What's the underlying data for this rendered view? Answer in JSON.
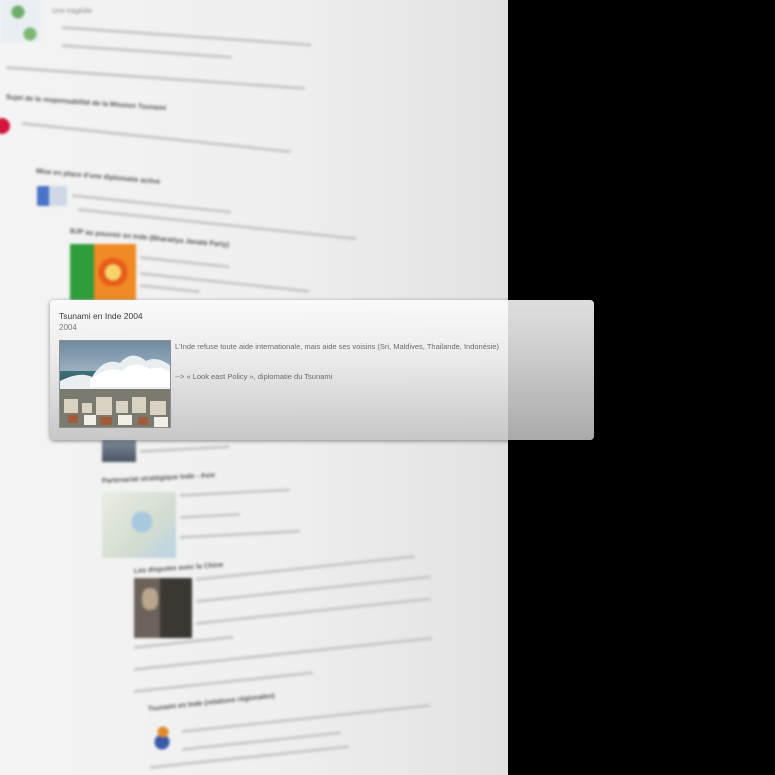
{
  "background_page": {
    "heading_responsibility": "Sujet de la responsabilité de la Mission Tsunami",
    "intro_text": "Une tragédie",
    "section_1": "Mise en place d'une diplomatie active",
    "section_2": "BJP au pouvoir en Inde (Bharatiya Janata Party)",
    "section_3": "Partenariat stratégique Inde - Asie",
    "section_4": "Les disputes avec la Chine",
    "section_5": "Tsunami en Inde (relations régionales)"
  },
  "card": {
    "title": "Tsunami en Inde 2004",
    "date": "2004",
    "description": "L'Inde refuse toute aide internationale, mais aide ses voisins (Sri, Maldives, Thailande, Indonésie)",
    "description_2": "--> « Look east Policy », diplomatie du Tsunami",
    "image_icon": "tsunami-photo"
  },
  "colors": {
    "background": "#000000",
    "page": "#f0f0f0",
    "card_top": "#fafafa",
    "card_bottom": "#c4c4c4",
    "accent_red": "#d4163c"
  }
}
